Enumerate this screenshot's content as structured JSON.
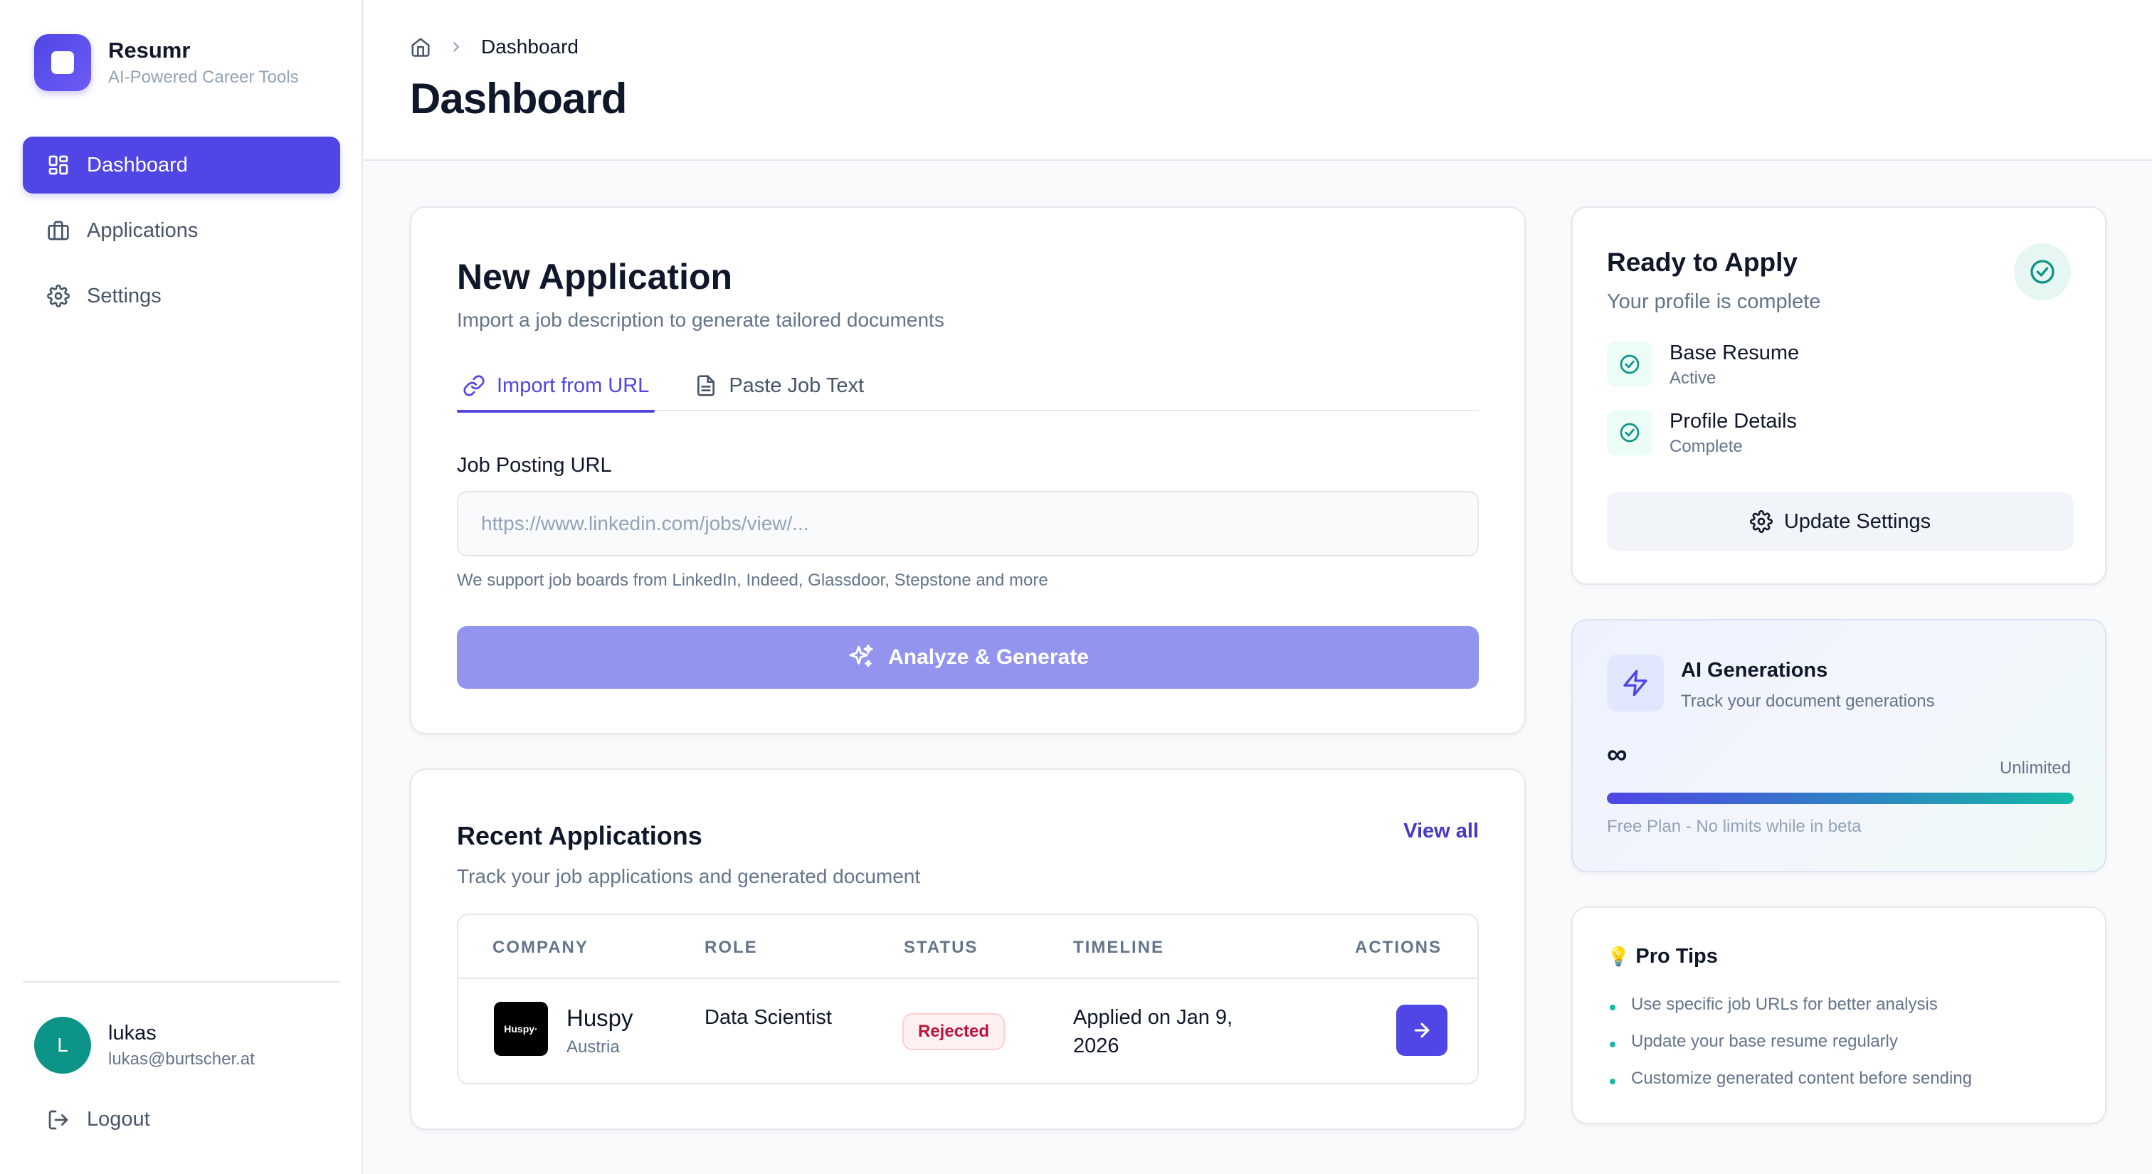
{
  "brand": {
    "name": "Resumr",
    "tagline": "AI-Powered Career Tools"
  },
  "sidebar": {
    "items": [
      {
        "label": "Dashboard",
        "icon": "grid-icon",
        "active": true
      },
      {
        "label": "Applications",
        "icon": "briefcase-icon",
        "active": false
      },
      {
        "label": "Settings",
        "icon": "gear-icon",
        "active": false
      }
    ],
    "user": {
      "initial": "L",
      "name": "lukas",
      "email": "lukas@burtscher.at"
    },
    "logout_label": "Logout"
  },
  "header": {
    "breadcrumb": "Dashboard",
    "title": "Dashboard"
  },
  "new_application": {
    "title": "New Application",
    "subtitle": "Import a job description to generate tailored documents",
    "tabs": [
      {
        "label": "Import from URL",
        "icon": "link-icon",
        "active": true
      },
      {
        "label": "Paste Job Text",
        "icon": "document-icon",
        "active": false
      }
    ],
    "field_label": "Job Posting URL",
    "placeholder": "https://www.linkedin.com/jobs/view/...",
    "value": "",
    "hint": "We support job boards from LinkedIn, Indeed, Glassdoor, Stepstone and more",
    "button_label": "Analyze & Generate"
  },
  "recent": {
    "title": "Recent Applications",
    "subtitle": "Track your job applications and generated document",
    "view_all": "View all",
    "columns": [
      "COMPANY",
      "ROLE",
      "STATUS",
      "TIMELINE",
      "ACTIONS"
    ],
    "rows": [
      {
        "logo_text": "Huspy·",
        "company": "Huspy",
        "location": "Austria",
        "role": "Data Scientist",
        "status": "Rejected",
        "timeline": "Applied on Jan 9, 2026"
      }
    ]
  },
  "ready": {
    "title": "Ready to Apply",
    "subtitle": "Your profile is complete",
    "items": [
      {
        "title": "Base Resume",
        "status": "Active"
      },
      {
        "title": "Profile Details",
        "status": "Complete"
      }
    ],
    "button_label": "Update Settings"
  },
  "ai": {
    "title": "AI Generations",
    "subtitle": "Track your document generations",
    "count": "∞",
    "limit": "Unlimited",
    "progress": 1.0,
    "note": "Free Plan - No limits while in beta"
  },
  "tips": {
    "title": "Pro Tips",
    "items": [
      "Use specific job URLs for better analysis",
      "Update your base resume regularly",
      "Customize generated content before sending"
    ]
  },
  "colors": {
    "accent": "#4f46e5",
    "accent_light": "#9294ee",
    "success": "#0d9488",
    "danger": "#be123c"
  }
}
